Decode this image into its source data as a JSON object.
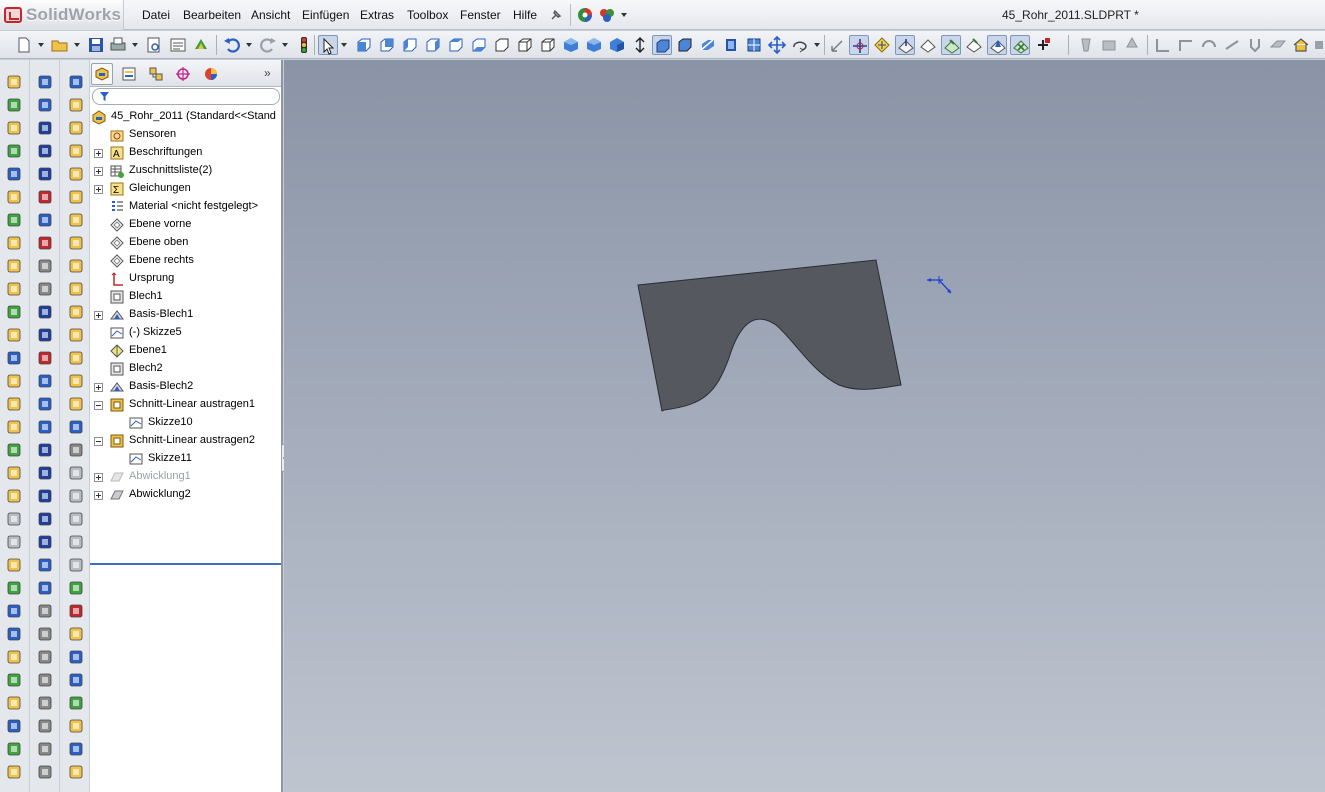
{
  "app": {
    "logo_text": "SolidWorks",
    "document_title": "45_Rohr_2011.SLDPRT *"
  },
  "menu": {
    "items": [
      "Datei",
      "Bearbeiten",
      "Ansicht",
      "Einfügen",
      "Extras",
      "Toolbox",
      "Fenster",
      "Hilfe"
    ]
  },
  "feature_manager": {
    "tabs": [
      "featuremanager-tab",
      "propertymanager-tab",
      "configurationmanager-tab",
      "dimxpert-tab",
      "display-manager-tab"
    ],
    "tree": [
      {
        "label": "45_Rohr_2011  (Standard<<Stand",
        "level": 0,
        "icon": "part-icon",
        "expander": "none",
        "disabled": false
      },
      {
        "label": "Sensoren",
        "level": 1,
        "icon": "sensor-folder-icon",
        "expander": "none",
        "disabled": false
      },
      {
        "label": "Beschriftungen",
        "level": 1,
        "icon": "annotations-icon",
        "expander": "plus",
        "disabled": false
      },
      {
        "label": "Zuschnittsliste(2)",
        "level": 1,
        "icon": "cutlist-icon",
        "expander": "plus",
        "disabled": false
      },
      {
        "label": "Gleichungen",
        "level": 1,
        "icon": "equations-icon",
        "expander": "plus",
        "disabled": false
      },
      {
        "label": "Material <nicht festgelegt>",
        "level": 1,
        "icon": "material-icon",
        "expander": "none",
        "disabled": false
      },
      {
        "label": "Ebene vorne",
        "level": 1,
        "icon": "plane-icon",
        "expander": "none",
        "disabled": false
      },
      {
        "label": "Ebene oben",
        "level": 1,
        "icon": "plane-icon",
        "expander": "none",
        "disabled": false
      },
      {
        "label": "Ebene rechts",
        "level": 1,
        "icon": "plane-icon",
        "expander": "none",
        "disabled": false
      },
      {
        "label": "Ursprung",
        "level": 1,
        "icon": "origin-icon",
        "expander": "none",
        "disabled": false
      },
      {
        "label": "Blech1",
        "level": 1,
        "icon": "sheetmetal-icon",
        "expander": "none",
        "disabled": false
      },
      {
        "label": "Basis-Blech1",
        "level": 1,
        "icon": "base-flange-icon",
        "expander": "plus",
        "disabled": false
      },
      {
        "label": "(-) Skizze5",
        "level": 1,
        "icon": "sketch-icon",
        "expander": "none",
        "disabled": false
      },
      {
        "label": "Ebene1",
        "level": 1,
        "icon": "plane-yellow-icon",
        "expander": "none",
        "disabled": false
      },
      {
        "label": "Blech2",
        "level": 1,
        "icon": "sheetmetal-icon",
        "expander": "none",
        "disabled": false
      },
      {
        "label": "Basis-Blech2",
        "level": 1,
        "icon": "base-flange-icon",
        "expander": "plus",
        "disabled": false
      },
      {
        "label": "Schnitt-Linear austragen1",
        "level": 1,
        "icon": "cut-extrude-icon",
        "expander": "minus",
        "disabled": false
      },
      {
        "label": "Skizze10",
        "level": 2,
        "icon": "sketch-icon",
        "expander": "none",
        "disabled": false
      },
      {
        "label": "Schnitt-Linear austragen2",
        "level": 1,
        "icon": "cut-extrude-icon",
        "expander": "minus",
        "disabled": false
      },
      {
        "label": "Skizze11",
        "level": 2,
        "icon": "sketch-icon",
        "expander": "none",
        "disabled": false
      },
      {
        "label": "Abwicklung1",
        "level": 1,
        "icon": "flat-pattern-icon",
        "expander": "plus",
        "disabled": true
      },
      {
        "label": "Abwicklung2",
        "level": 1,
        "icon": "flat-pattern-icon",
        "expander": "plus",
        "disabled": false
      }
    ]
  },
  "colors": {
    "part_face": "#565860",
    "part_edge": "#2a2c33",
    "viewport_top": "#8a94a6",
    "viewport_bottom": "#bfc5cf",
    "accent": "#3b6fc4"
  }
}
